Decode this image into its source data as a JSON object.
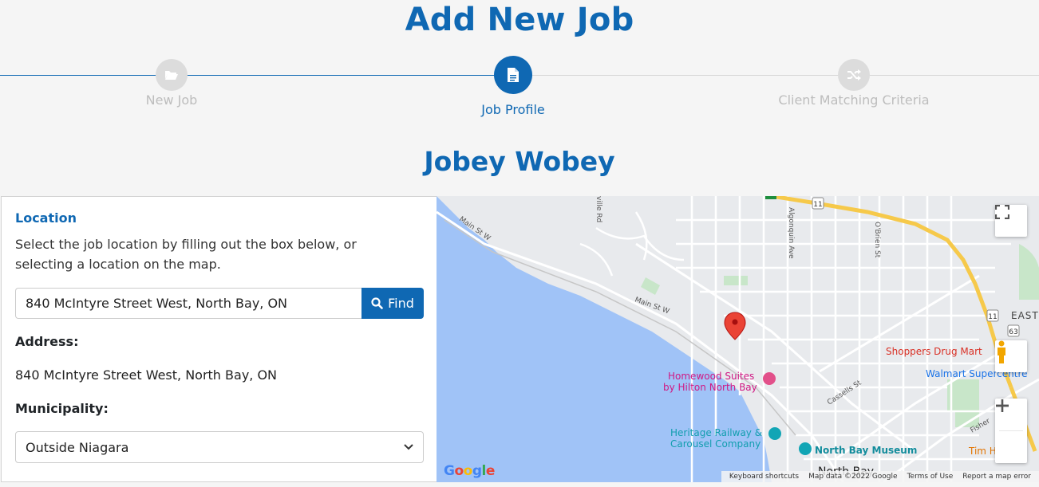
{
  "page": {
    "title": "Add New Job",
    "job_name": "Jobey Wobey"
  },
  "stepper": {
    "steps": [
      {
        "label": "New Job",
        "icon": "folder-open-icon",
        "state": "done"
      },
      {
        "label": "Job Profile",
        "icon": "file-text-icon",
        "state": "active"
      },
      {
        "label": "Client Matching Criteria",
        "icon": "shuffle-icon",
        "state": "pending"
      }
    ]
  },
  "location": {
    "heading": "Location",
    "help": "Select the job location by filling out the box below, or selecting a location on the map.",
    "search_value": "840 McIntyre Street West, North Bay, ON",
    "find_label": "Find",
    "address_label": "Address:",
    "address_value": "840 McIntyre Street West, North Bay, ON",
    "municipality_label": "Municipality:",
    "municipality_value": "Outside Niagara"
  },
  "map": {
    "labels": {
      "main_st_w_1": "Main St W",
      "main_st_w_2": "Main St W",
      "ville_rd": "ville Rd",
      "algonquin": "Algonquin Ave",
      "obrien": "O'Brien St",
      "cassells": "Cassells St",
      "fisher": "Fisher",
      "homewood": "Homewood Suites",
      "homewood2": "by Hilton North Bay",
      "heritage": "Heritage Railway &",
      "heritage2": "Carousel Company",
      "museum": "North Bay Museum",
      "shoppers": "Shoppers Drug Mart",
      "walmart": "Walmart Supercentre",
      "tim": "Tim H",
      "north_bay": "North Bay",
      "east": "EAST",
      "hwy11a": "11",
      "hwy11b": "11",
      "hwy63": "63"
    },
    "footer": {
      "shortcuts": "Keyboard shortcuts",
      "data": "Map data ©2022 Google",
      "terms": "Terms of Use",
      "report": "Report a map error"
    },
    "logo": "Google",
    "colors": {
      "water": "#a0c3f7",
      "park": "#c8e6c9",
      "highway": "#f6c94a",
      "pin": "#ea4335"
    }
  }
}
